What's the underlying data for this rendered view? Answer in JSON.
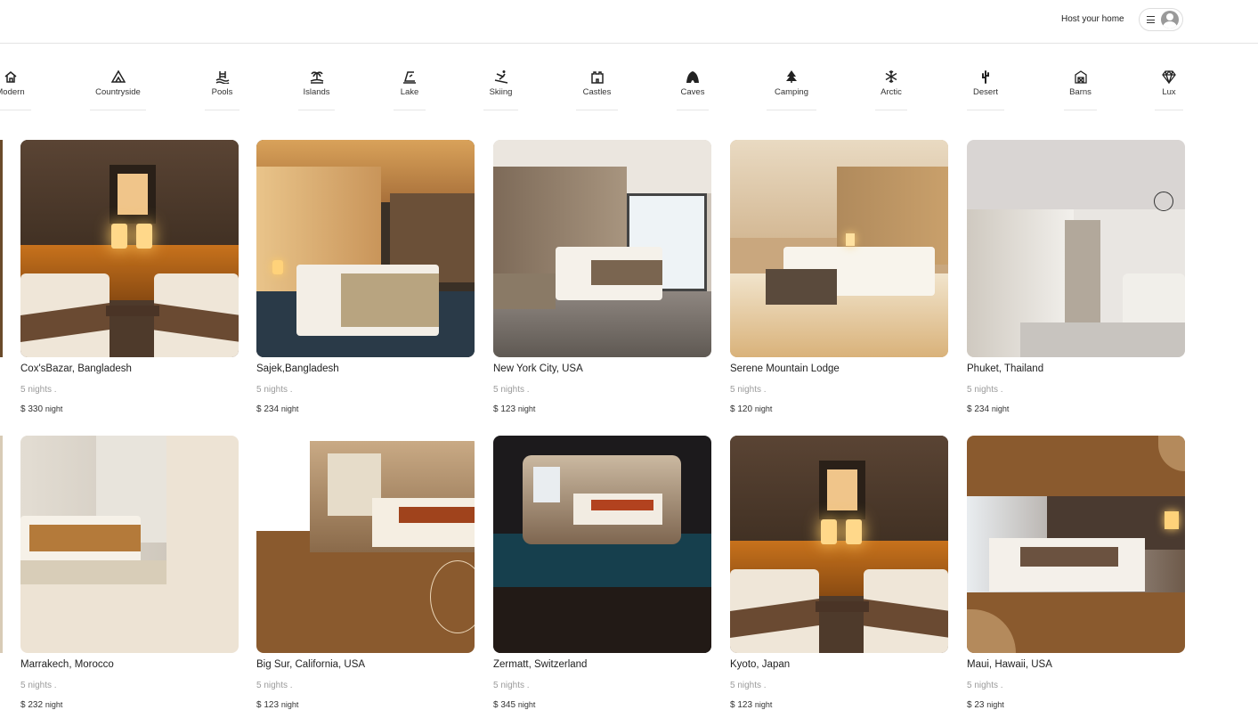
{
  "header": {
    "host_label": "Host your home",
    "menu_icon": "hamburger-icon",
    "avatar_icon": "user-avatar-icon"
  },
  "categories": [
    {
      "label": "Modern",
      "icon": "modern-house-icon"
    },
    {
      "label": "Countryside",
      "icon": "tent-icon"
    },
    {
      "label": "Pools",
      "icon": "pool-icon"
    },
    {
      "label": "Islands",
      "icon": "island-icon"
    },
    {
      "label": "Lake",
      "icon": "lake-icon"
    },
    {
      "label": "Skiing",
      "icon": "skiing-icon"
    },
    {
      "label": "Castles",
      "icon": "castle-icon"
    },
    {
      "label": "Caves",
      "icon": "cave-icon"
    },
    {
      "label": "Camping",
      "icon": "camping-icon"
    },
    {
      "label": "Arctic",
      "icon": "snowflake-icon"
    },
    {
      "label": "Desert",
      "icon": "cactus-icon"
    },
    {
      "label": "Barns",
      "icon": "barn-icon"
    },
    {
      "label": "Lux",
      "icon": "diamond-icon"
    }
  ],
  "listings": [
    {
      "title": "Cox'sBazar, Bangladesh",
      "nights": "5 nights .",
      "price": "$ 330",
      "unit": "night"
    },
    {
      "title": "Sajek,Bangladesh",
      "nights": "5 nights .",
      "price": "$ 234",
      "unit": "night"
    },
    {
      "title": "New York City, USA",
      "nights": "5 nights .",
      "price": "$ 123",
      "unit": "night"
    },
    {
      "title": "Serene Mountain Lodge",
      "nights": "5 nights .",
      "price": "$ 120",
      "unit": "night"
    },
    {
      "title": "Phuket, Thailand",
      "nights": "5 nights .",
      "price": "$ 234",
      "unit": "night"
    },
    {
      "title": "Marrakech, Morocco",
      "nights": "5 nights .",
      "price": "$ 232",
      "unit": "night"
    },
    {
      "title": "Big Sur, California, USA",
      "nights": "5 nights .",
      "price": "$ 123",
      "unit": "night"
    },
    {
      "title": "Zermatt, Switzerland",
      "nights": "5 nights .",
      "price": "$ 345",
      "unit": "night"
    },
    {
      "title": "Kyoto, Japan",
      "nights": "5 nights .",
      "price": "$ 123",
      "unit": "night"
    },
    {
      "title": "Maui, Hawaii, USA",
      "nights": "5 nights .",
      "price": "$ 23",
      "unit": "night"
    }
  ],
  "colors": {
    "brown": "#8a5a2e",
    "cream": "#ede3d4",
    "warm_wood": "#5e4330",
    "border": "#e4e4e4"
  }
}
